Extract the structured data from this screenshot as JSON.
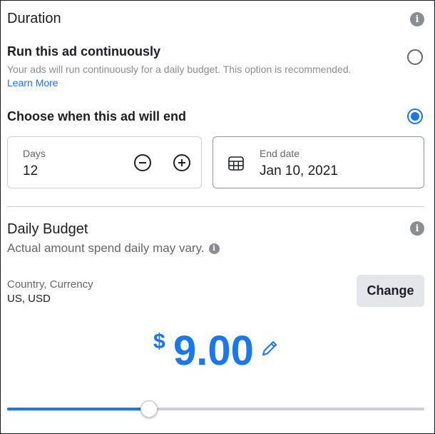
{
  "duration": {
    "title": "Duration",
    "run_continuously": {
      "label": "Run this ad continuously",
      "description": "Your ads will run continuously for a daily budget. This option is recommended.",
      "link": "Learn More",
      "selected": false
    },
    "choose_end": {
      "label": "Choose when this ad will end",
      "selected": true
    },
    "days": {
      "label": "Days",
      "value": "12",
      "minus": "−",
      "plus": "+"
    },
    "end_date": {
      "label": "End date",
      "value": "Jan 10, 2021"
    }
  },
  "budget": {
    "title": "Daily Budget",
    "subtitle": "Actual amount spend daily may vary.",
    "country_label": "Country, Currency",
    "country_value": "US, USD",
    "change_label": "Change",
    "currency_symbol": "$",
    "amount": "9.00",
    "slider_fraction": 0.34
  },
  "colors": {
    "accent": "#1877f2",
    "muted": "#8a8d91",
    "button_bg": "#e4e6eb"
  },
  "icons": [
    "info-icon",
    "calendar-icon",
    "pencil-icon",
    "minus-circle-icon",
    "plus-circle-icon"
  ]
}
